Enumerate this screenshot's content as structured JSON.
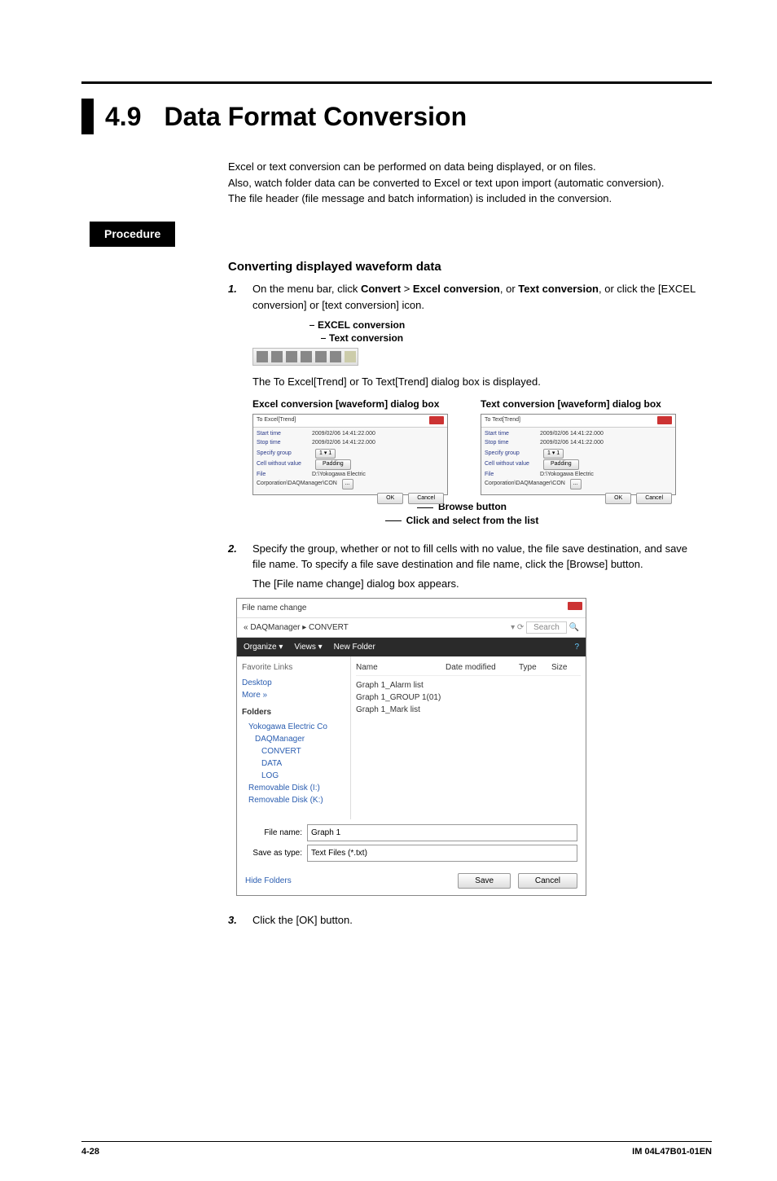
{
  "section": {
    "number": "4.9",
    "title": "Data Format Conversion"
  },
  "intro": {
    "p1": "Excel or text conversion can be performed on data being displayed, or on files.",
    "p2": "Also, watch folder data can be converted to Excel or text upon import (automatic conversion).",
    "p3": "The file header (file message and batch information) is included in the conversion."
  },
  "procedure_label": "Procedure",
  "subhead": "Converting displayed waveform data",
  "steps": {
    "s1_num": "1.",
    "s1_a": "On the menu bar, click ",
    "s1_b": "Convert",
    "s1_c": " > ",
    "s1_d": "Excel conversion",
    "s1_e": ", or ",
    "s1_f": "Text conversion",
    "s1_g": ", or click the [EXCEL conversion] or [text conversion] icon.",
    "conv_excel": "EXCEL conversion",
    "conv_text": "Text conversion",
    "s1_after": "The To Excel[Trend] or To Text[Trend] dialog box is displayed.",
    "dlg_excel_title": "Excel conversion [waveform] dialog box",
    "dlg_text_title": "Text conversion [waveform] dialog box",
    "browse_label": "Browse button",
    "click_select": "Click and select from the list",
    "s2_num": "2.",
    "s2": "Specify the group, whether or not to fill cells with no value, the file save destination, and save file name. To specify a file save destination and file name, click the [Browse] button.",
    "s2_after": "The [File name change] dialog box appears.",
    "s3_num": "3.",
    "s3": "Click the [OK] button."
  },
  "dlg": {
    "hdr_excel": "To Excel[Trend]",
    "hdr_text": "To Text[Trend]",
    "start_lbl": "Start time",
    "stop_lbl": "Stop time",
    "group_lbl": "Specify group",
    "cell_lbl": "Cell without value",
    "file_lbl": "File",
    "dt1": "2009/02/06 14:41:22.000",
    "dt2": "2009/02/06 14:41:22.000",
    "padding": "Padding",
    "path": "D:\\Yokogawa Electric Corporation\\DAQManager\\CON",
    "ok": "OK",
    "cancel": "Cancel"
  },
  "save": {
    "title": "File name change",
    "breadcrumb": "« DAQManager ▸ CONVERT",
    "search": "Search",
    "organize": "Organize ▾",
    "views": "Views ▾",
    "newfolder": "New Folder",
    "fav": "Favorite Links",
    "desktop": "Desktop",
    "more": "More »",
    "folders": "Folders",
    "tree": [
      "Yokogawa Electric Co",
      "DAQManager",
      "CONVERT",
      "DATA",
      "LOG",
      "Removable Disk (I:)",
      "Removable Disk (K:)"
    ],
    "cols": {
      "name": "Name",
      "date": "Date modified",
      "type": "Type",
      "size": "Size"
    },
    "files": [
      "Graph 1_Alarm list",
      "Graph 1_GROUP 1(01)",
      "Graph 1_Mark list"
    ],
    "fname_lbl": "File name:",
    "fname_val": "Graph 1",
    "stype_lbl": "Save as type:",
    "stype_val": "Text Files (*.txt)",
    "hide": "Hide Folders",
    "save_btn": "Save",
    "cancel_btn": "Cancel"
  },
  "footer": {
    "page": "4-28",
    "doc": "IM 04L47B01-01EN"
  }
}
